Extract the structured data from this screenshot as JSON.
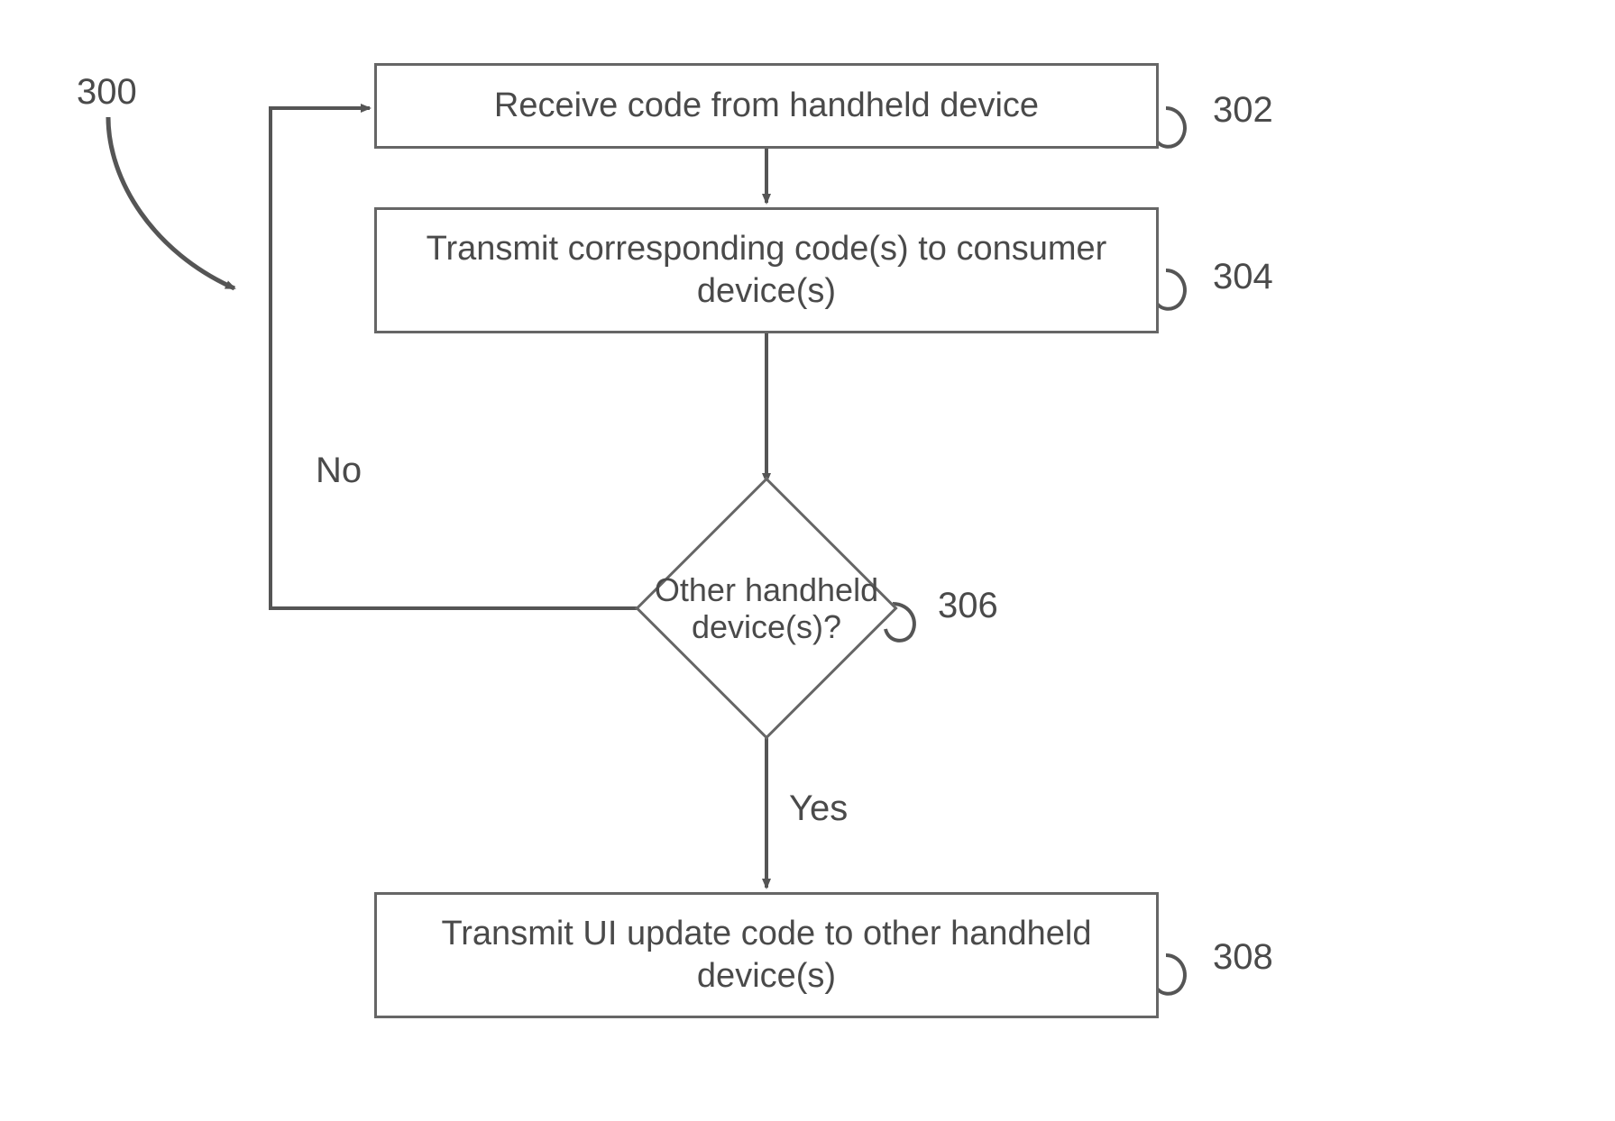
{
  "flow": {
    "title_ref": "300",
    "steps": {
      "s302": {
        "text": "Receive code from handheld device",
        "ref": "302"
      },
      "s304": {
        "text": "Transmit corresponding code(s) to consumer device(s)",
        "ref": "304"
      },
      "s306": {
        "text": "Other handheld device(s)?",
        "ref": "306"
      },
      "s308": {
        "text": "Transmit UI update code to other handheld device(s)",
        "ref": "308"
      }
    },
    "branches": {
      "no": "No",
      "yes": "Yes"
    }
  }
}
